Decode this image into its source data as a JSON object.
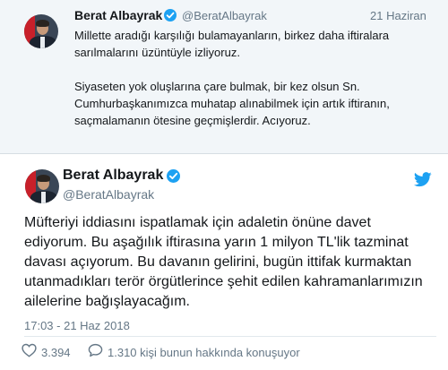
{
  "quoted_tweet": {
    "name": "Berat Albayrak",
    "handle": "@BeratAlbayrak",
    "date": "21 Haziran",
    "paragraph1": "Millette aradığı karşılığı bulamayanların, birkez daha iftiralara sarılmalarını üzüntüyle izliyoruz.",
    "paragraph2": "Siyaseten yok oluşlarına çare bulmak, bir kez olsun Sn. Cumhurbaşkanımızca muhatap alınabilmek için artık iftiranın, saçmalamanın ötesine geçmişlerdir. Acıyoruz."
  },
  "main_tweet": {
    "name": "Berat Albayrak",
    "handle": "@BeratAlbayrak",
    "text": "Müfteriyi iddiasını ispatlamak için adaletin önüne davet ediyorum. Bu aşağılık iftirasına yarın 1 milyon TL'lik tazminat davası açıyorum. Bu davanın gelirini, bugün ittifak kurmaktan utanmadıkları terör örgütlerince şehit edilen kahramanlarımızın ailelerine bağışlayacağım.",
    "timestamp": "17:03 - 21 Haz 2018",
    "likes": "3.394",
    "conversation": "1.310 kişi bunun hakkında konuşuyor"
  },
  "icons": {
    "verified": "verified-badge-icon",
    "brand": "twitter-bird-icon",
    "like": "heart-icon",
    "reply": "speech-bubble-icon"
  },
  "colors": {
    "accent": "#1da1f2",
    "muted": "#657786",
    "quoted_background": "#f2f6f9"
  }
}
